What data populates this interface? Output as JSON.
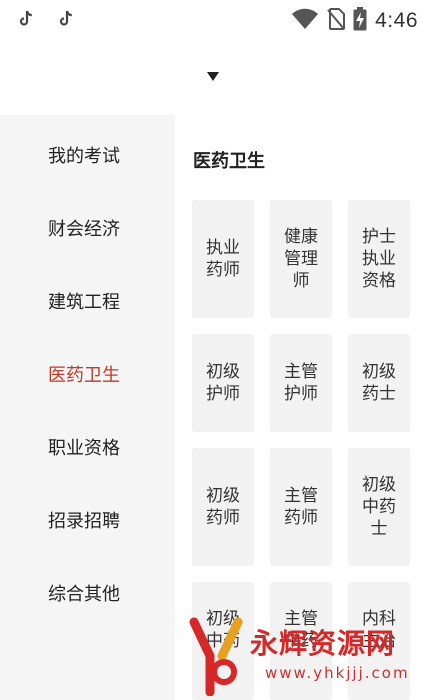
{
  "status_bar": {
    "time": "4:46",
    "icons": [
      "tiktok-icon",
      "tiktok-icon",
      "wifi-icon",
      "no-sim-icon",
      "battery-charging-icon"
    ]
  },
  "dropdown": {
    "icon": "caret-down-icon"
  },
  "sidebar": {
    "items": [
      {
        "label": "我的考试"
      },
      {
        "label": "财会经济"
      },
      {
        "label": "建筑工程"
      },
      {
        "label": "医药卫生"
      },
      {
        "label": "职业资格"
      },
      {
        "label": "招录招聘"
      },
      {
        "label": "综合其他"
      }
    ],
    "active": "医药卫生",
    "active_color": "#c0392b"
  },
  "main": {
    "section_title": "医药卫生",
    "cards": [
      {
        "label": "执业药师"
      },
      {
        "label": "健康管理师"
      },
      {
        "label": "护士执业资格"
      },
      {
        "label": "初级护师"
      },
      {
        "label": "主管护师"
      },
      {
        "label": "初级药士"
      },
      {
        "label": "初级药师"
      },
      {
        "label": "主管药师"
      },
      {
        "label": "初级中药士"
      },
      {
        "label": "初级中药"
      },
      {
        "label": "主管中药"
      },
      {
        "label": "内科主治"
      }
    ]
  },
  "watermark": {
    "text": "永辉资源网",
    "url": "www.yhkjjj.com",
    "color": "#d62828"
  }
}
